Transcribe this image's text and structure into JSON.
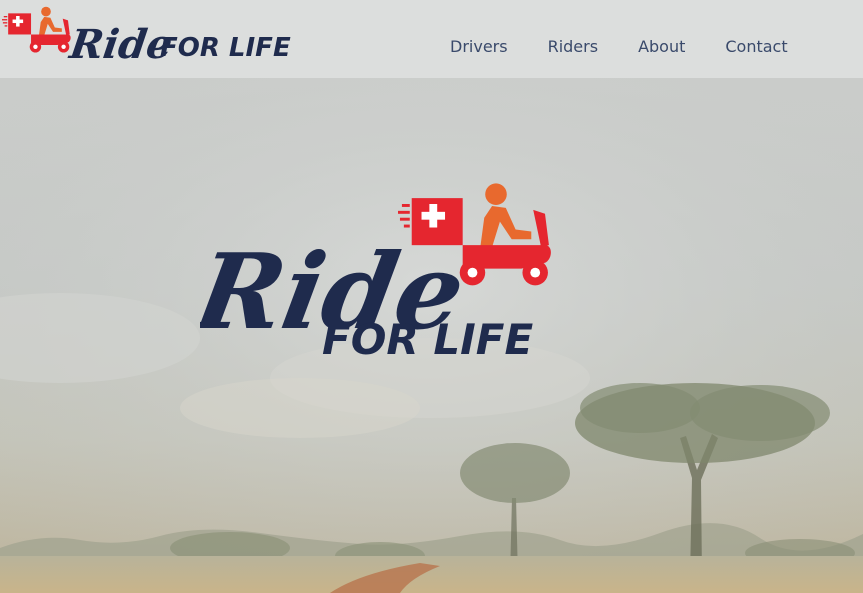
{
  "brand": {
    "name": "Ride For Life",
    "wordmark_script": "Ride",
    "wordmark_caps": "FOR LIFE",
    "colors": {
      "navy": "#1f2b4d",
      "red": "#e5262f",
      "orange": "#e8692e",
      "header_bg": "#dcdedd"
    }
  },
  "nav": {
    "items": [
      {
        "label": "Drivers"
      },
      {
        "label": "Riders"
      },
      {
        "label": "About"
      },
      {
        "label": "Contact"
      }
    ]
  },
  "hero": {
    "background": "savanna-landscape-with-acacia-trees",
    "logo_icon": "scooter-medical-rider-icon"
  }
}
